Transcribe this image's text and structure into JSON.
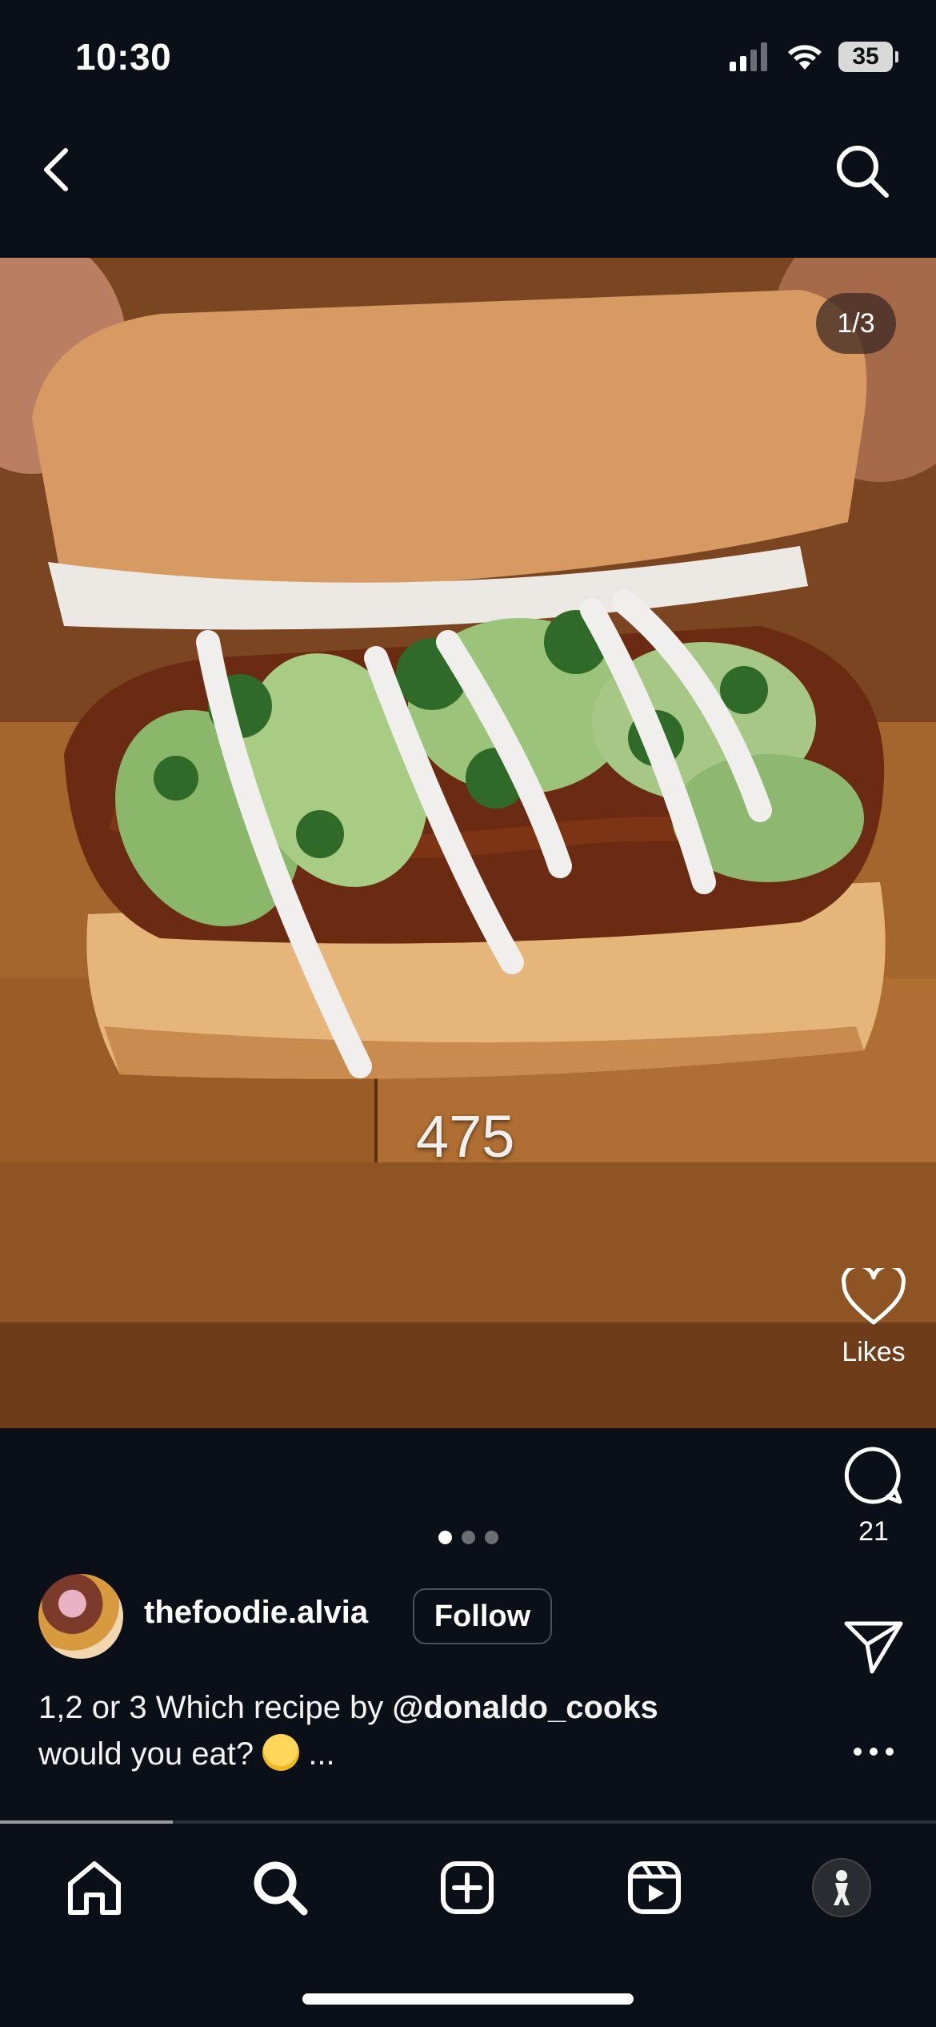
{
  "status_bar": {
    "time": "10:30",
    "battery": "35"
  },
  "top_bar": {
    "back_icon": "chevron-left-icon",
    "search_icon": "search-icon"
  },
  "photo": {
    "counter": "1/3",
    "overlay_text": "475"
  },
  "actions": {
    "likes_label": "Likes",
    "comments_count": "21",
    "share_icon": "send-icon",
    "more_icon": "ellipsis-icon"
  },
  "pagination": {
    "current": 1,
    "total": 3
  },
  "post": {
    "username": "thefoodie.alvia",
    "follow_label": "Follow",
    "caption_part1": "1,2 or 3 Which recipe by ",
    "caption_mention": "@donaldo_cooks",
    "caption_part2": "would you eat? ",
    "caption_more": " ..."
  },
  "video_progress": 0.185,
  "bottom_nav": {
    "items": [
      "home-icon",
      "search-icon",
      "create-icon",
      "reels-icon",
      "profile-icon"
    ]
  },
  "colors": {
    "background": "#0b0f17",
    "text": "#ffffff",
    "follow_border": "#4b4f57",
    "dot_inactive": "#6b6e74"
  }
}
